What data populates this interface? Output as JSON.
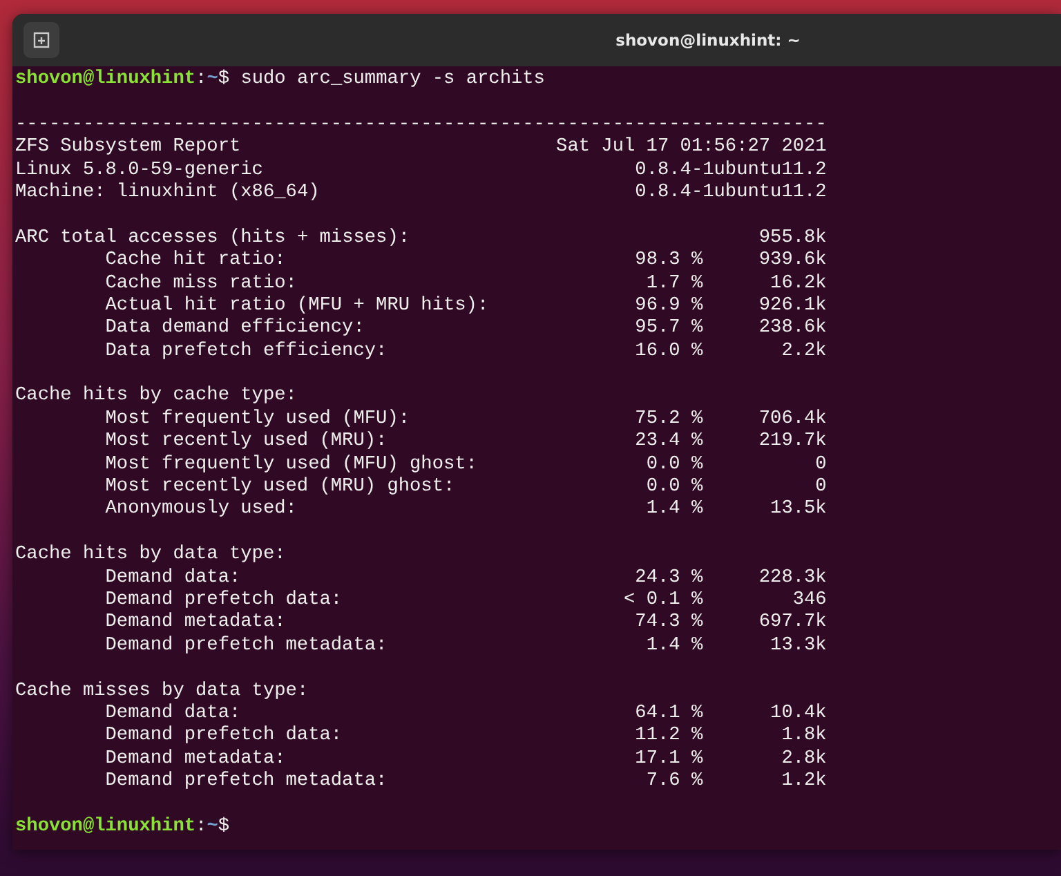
{
  "window": {
    "title": "shovon@linuxhint: ~"
  },
  "command_prompt": {
    "user_host": "shovon@linuxhint",
    "separator": ":",
    "path": "~",
    "symbol": "$",
    "command": "sudo arc_summary -s archits"
  },
  "rule": "------------------------------------------------------------------------",
  "report_header": [
    {
      "label": "ZFS Subsystem Report",
      "value": "Sat Jul 17 01:56:27 2021"
    },
    {
      "label": "Linux 5.8.0-59-generic",
      "value": "0.8.4-1ubuntu11.2"
    },
    {
      "label": "Machine: linuxhint (x86_64)",
      "value": "0.8.4-1ubuntu11.2"
    }
  ],
  "sections": [
    {
      "title": "ARC total accesses (hits + misses):",
      "value": "955.8k",
      "children": [
        {
          "label": "Cache hit ratio:",
          "percent": "98.3 %",
          "count": "939.6k"
        },
        {
          "label": "Cache miss ratio:",
          "percent": "1.7 %",
          "count": "16.2k"
        },
        {
          "label": "Actual hit ratio (MFU + MRU hits):",
          "percent": "96.9 %",
          "count": "926.1k"
        },
        {
          "label": "Data demand efficiency:",
          "percent": "95.7 %",
          "count": "238.6k"
        },
        {
          "label": "Data prefetch efficiency:",
          "percent": "16.0 %",
          "count": "2.2k"
        }
      ]
    },
    {
      "title": "Cache hits by cache type:",
      "children": [
        {
          "label": "Most frequently used (MFU):",
          "percent": "75.2 %",
          "count": "706.4k"
        },
        {
          "label": "Most recently used (MRU):",
          "percent": "23.4 %",
          "count": "219.7k"
        },
        {
          "label": "Most frequently used (MFU) ghost:",
          "percent": "0.0 %",
          "count": "0"
        },
        {
          "label": "Most recently used (MRU) ghost:",
          "percent": "0.0 %",
          "count": "0"
        },
        {
          "label": "Anonymously used:",
          "percent": "1.4 %",
          "count": "13.5k"
        }
      ]
    },
    {
      "title": "Cache hits by data type:",
      "children": [
        {
          "label": "Demand data:",
          "percent": "24.3 %",
          "count": "228.3k"
        },
        {
          "label": "Demand prefetch data:",
          "percent": "< 0.1 %",
          "count": "346"
        },
        {
          "label": "Demand metadata:",
          "percent": "74.3 %",
          "count": "697.7k"
        },
        {
          "label": "Demand prefetch metadata:",
          "percent": "1.4 %",
          "count": "13.3k"
        }
      ]
    },
    {
      "title": "Cache misses by data type:",
      "children": [
        {
          "label": "Demand data:",
          "percent": "64.1 %",
          "count": "10.4k"
        },
        {
          "label": "Demand prefetch data:",
          "percent": "11.2 %",
          "count": "1.8k"
        },
        {
          "label": "Demand metadata:",
          "percent": "17.1 %",
          "count": "2.8k"
        },
        {
          "label": "Demand prefetch metadata:",
          "percent": "7.6 %",
          "count": "1.2k"
        }
      ]
    }
  ],
  "final_prompt": {
    "user_host": "shovon@linuxhint",
    "separator": ":",
    "path": "~",
    "symbol": "$"
  }
}
